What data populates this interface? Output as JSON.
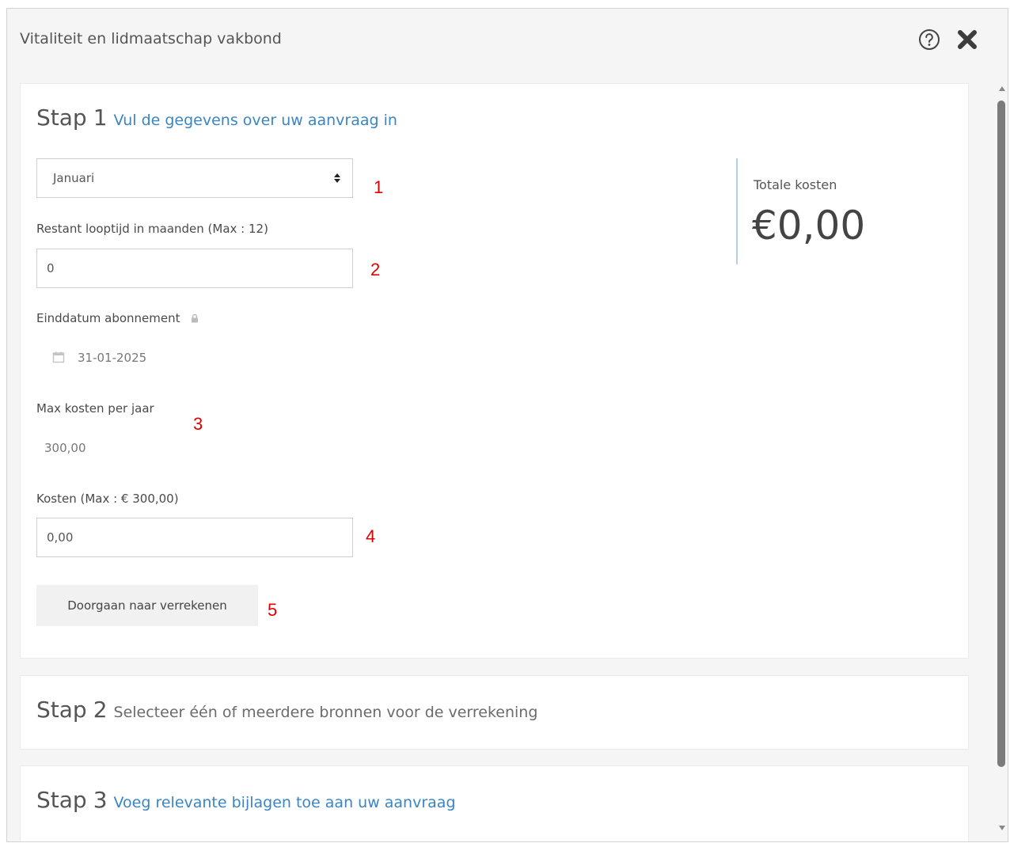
{
  "dialog": {
    "title": "Vitaliteit en lidmaatschap vakbond",
    "help_icon": "question-circle-icon",
    "close_icon": "close-x-icon"
  },
  "step1": {
    "label": "Stap",
    "number": "1",
    "subtitle": "Vul de gegevens over uw aanvraag in",
    "month_select": {
      "value": "Januari"
    },
    "looptijd": {
      "label": "Restant looptijd in maanden (Max : 12)",
      "value": "0"
    },
    "einddatum": {
      "label": "Einddatum abonnement",
      "value": "31-01-2025"
    },
    "max_kosten": {
      "label": "Max kosten per jaar",
      "value": "300,00"
    },
    "kosten": {
      "label": "Kosten (Max : € 300,00)",
      "value": "0,00"
    },
    "button_label": "Doorgaan naar verrekenen",
    "totals": {
      "label": "Totale kosten",
      "value": "€0,00"
    }
  },
  "step2": {
    "label": "Stap",
    "number": "2",
    "subtitle": "Selecteer één of meerdere bronnen voor de verrekening"
  },
  "step3": {
    "label": "Stap",
    "number": "3",
    "subtitle": "Voeg relevante bijlagen toe aan uw aanvraag"
  },
  "annotations": [
    "1",
    "2",
    "3",
    "4",
    "5"
  ],
  "colors": {
    "accent": "#3a85c3",
    "annotation": "#e00000",
    "divider": "#b7cfe3"
  }
}
